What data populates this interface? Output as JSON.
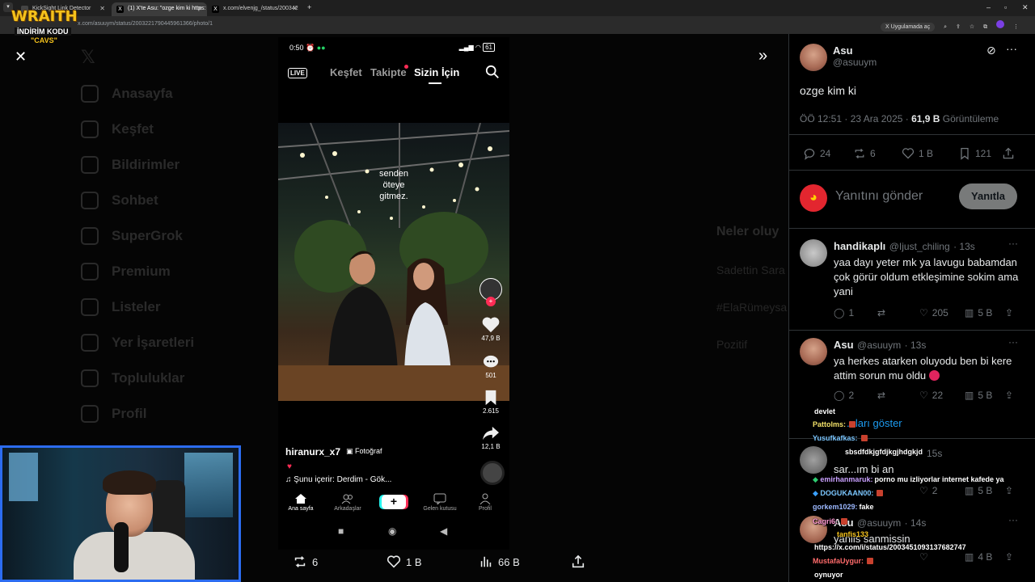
{
  "browser": {
    "tabs": [
      {
        "title": "KickSight Link Detector",
        "active": false
      },
      {
        "title": "(1) X'te Asu: \"ozge kim ki https:",
        "active": true
      },
      {
        "title": "x.com/elvenjg_/status/200342",
        "active": false
      }
    ],
    "new_tab": "+",
    "url": "x.com/asuuym/status/2003221790445961366/photo/1",
    "open_in_app": "Uygulamada aç",
    "window_controls": [
      "–",
      "▫",
      "✕"
    ]
  },
  "stream_logo": {
    "title": "WRAITH",
    "promo": "İNDİRİM KODU",
    "code": "\"CAVS\""
  },
  "background_nav": [
    "Anasayfa",
    "Keşfet",
    "Bildirimler",
    "Sohbet",
    "SuperGrok",
    "Premium",
    "Listeler",
    "Yer İşaretleri",
    "Topluluklar",
    "Profil"
  ],
  "background_right": {
    "heading": "Neler oluy",
    "items": [
      "Sadettin Sara",
      "#ElaRümeysa",
      "Pozitif"
    ]
  },
  "phone": {
    "time": "0:50",
    "battery": "61",
    "tabs": [
      "Keşfet",
      "Takipte",
      "Sizin İçin"
    ],
    "live": "LIVE",
    "caption": [
      "senden",
      "öteye",
      "gitmez."
    ],
    "likes": "47,9 B",
    "comments": "501",
    "saves": "2.615",
    "shares": "12,1 B",
    "username": "hiranurx_x7",
    "post_type": "Fotoğraf",
    "heart": "♥",
    "song": "♫ Şunu içerir: Derdim - Gök...",
    "nav": [
      "Ana sayfa",
      "Arkadaşlar",
      "+",
      "Gelen kutusu",
      "Profil"
    ]
  },
  "media_bar": {
    "reposts": "6",
    "likes": "1 B",
    "views": "66 B"
  },
  "post": {
    "name": "Asu",
    "handle": "@asuuym",
    "text": "ozge kim ki",
    "time": "ÖÖ 12:51 · 23 Ara 2025 · ",
    "views_num": "61,9 B",
    "views_label": " Görüntüleme",
    "replies": "24",
    "reposts": "6",
    "likes": "1 B",
    "bookmarks": "121",
    "reply_placeholder": "Yanıtını gönder",
    "reply_button": "Yanıtla"
  },
  "comments": [
    {
      "name": "handikaplı",
      "handle": "@Ijust_chiling",
      "time": "· 13s",
      "text": "yaa dayı yeter mk ya lavugu babamdan çok görür oldum etkleşimine sokim ama yani",
      "replies": "1",
      "reposts": "",
      "likes": "205",
      "views": "5 B"
    },
    {
      "name": "Asu",
      "handle": "@asuuym",
      "time": "· 13s",
      "text": "ya herkes atarken oluyodu ben bi kere attim sorun mu oldu",
      "replies": "2",
      "reposts": "",
      "likes": "22",
      "views": "5 B"
    },
    {
      "name": "",
      "handle": "",
      "time": "15s",
      "text": "sar...ım bi an",
      "replies": "",
      "reposts": "",
      "likes": "2",
      "views": "5 B"
    },
    {
      "name": "Asu",
      "handle": "@asuuym",
      "time": "· 14s",
      "text": "yanlis sanmissin",
      "replies": "",
      "reposts": "",
      "likes": "",
      "views": "4 B"
    }
  ],
  "show_more": "...ları göster",
  "chat": [
    {
      "user": "",
      "msg": "devlet"
    },
    {
      "user": "Pattolms:",
      "msg": ""
    },
    {
      "user": "Yusufkafkas:",
      "msg": ""
    },
    {
      "user": "",
      "msg": "sbsdfdkjgfdjkgjhdgkjd"
    },
    {
      "user": "emirhanmaruk:",
      "msg": "porno mu izliyorlar internet kafede ya"
    },
    {
      "user": "DOGUKAAN00:",
      "msg": ""
    },
    {
      "user": "gorkem1029:",
      "msg": "fake"
    },
    {
      "user": "Cagri6:",
      "msg": ""
    },
    {
      "user": "",
      "msg": "tanfis133"
    },
    {
      "user": "",
      "msg": "https://x.com/i/status/2003451093137682747"
    },
    {
      "user": "MustafaUygur:",
      "msg": ""
    },
    {
      "user": "",
      "msg": "oynuyor"
    }
  ],
  "colors": {
    "accent": "#1d9bf0",
    "tiktok_red": "#fe2c55",
    "cam_border": "#2c6cf0"
  }
}
